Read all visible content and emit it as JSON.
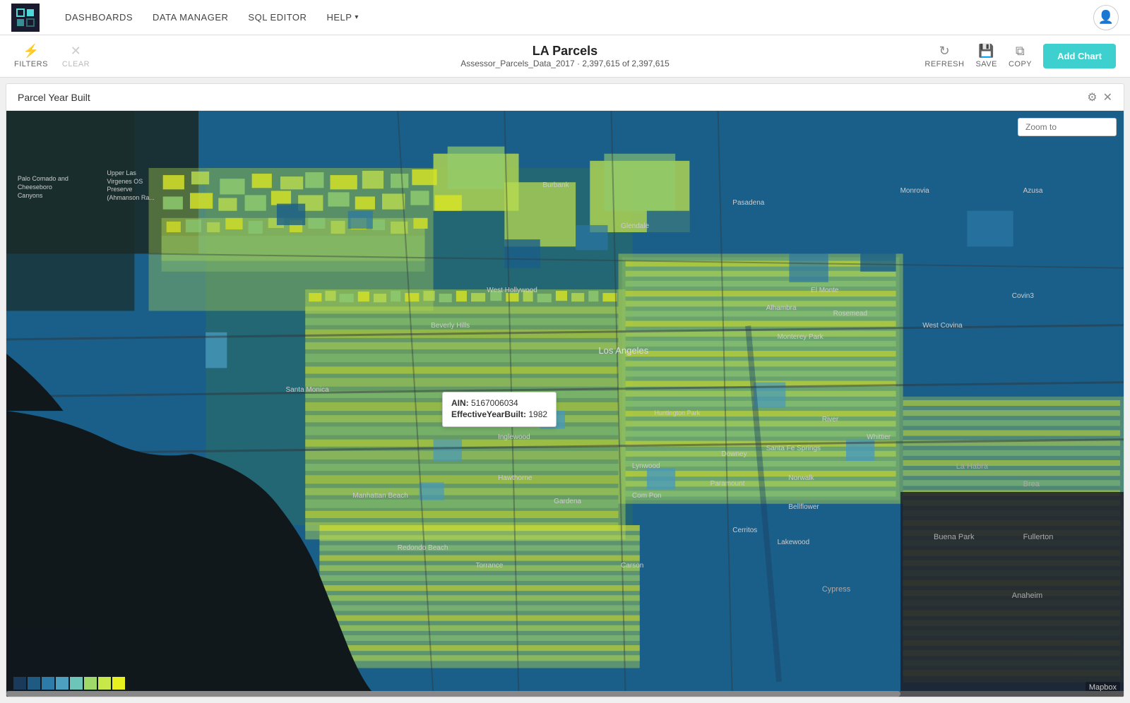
{
  "nav": {
    "logo_alt": "MAPD Logo",
    "links": [
      {
        "label": "DASHBOARDS",
        "id": "dashboards"
      },
      {
        "label": "DATA MANAGER",
        "id": "data-manager"
      },
      {
        "label": "SQL EDITOR",
        "id": "sql-editor"
      },
      {
        "label": "HELP",
        "id": "help",
        "has_arrow": true
      }
    ]
  },
  "toolbar": {
    "filters_label": "FILTERS",
    "clear_label": "CLEAR",
    "title": "LA Parcels",
    "subtitle_dataset": "Assessor_Parcels_Data_2017",
    "subtitle_count": "2,397,615 of 2,397,615",
    "refresh_label": "REFRESH",
    "save_label": "SAVE",
    "copy_label": "COPY",
    "add_chart_label": "Add Chart"
  },
  "map_panel": {
    "title": "Parcel Year Built",
    "zoom_placeholder": "Zoom to",
    "tooltip": {
      "ain_label": "AIN:",
      "ain_value": "5167006034",
      "year_label": "EffectiveYearBuilt:",
      "year_value": "1982"
    },
    "mapbox_attribution": "Mapbox"
  },
  "legend": {
    "colors": [
      "#1a3a5c",
      "#1e5a82",
      "#2d7ba8",
      "#4da0c0",
      "#6dc4b8",
      "#9fd96a",
      "#c8e84a",
      "#e8f020"
    ]
  },
  "city_labels": [
    {
      "name": "Burbank",
      "top": "12%",
      "left": "52%"
    },
    {
      "name": "Glendale",
      "top": "19%",
      "left": "58%"
    },
    {
      "name": "Pasadena",
      "top": "16%",
      "left": "68%"
    },
    {
      "name": "Monrovia",
      "top": "14%",
      "left": "82%"
    },
    {
      "name": "West Hollywood",
      "top": "30%",
      "left": "45%"
    },
    {
      "name": "Beverly Hills",
      "top": "36%",
      "left": "40%"
    },
    {
      "name": "Los Angeles",
      "top": "39%",
      "left": "57%"
    },
    {
      "name": "Alhambra",
      "top": "35%",
      "left": "69%"
    },
    {
      "name": "El Monte",
      "top": "32%",
      "left": "72%"
    },
    {
      "name": "Rosemead",
      "top": "35%",
      "left": "74%"
    },
    {
      "name": "Monterey Park",
      "top": "38%",
      "left": "69%"
    },
    {
      "name": "West Covina",
      "top": "37%",
      "left": "83%"
    },
    {
      "name": "Covin3",
      "top": "32%",
      "left": "90%"
    },
    {
      "name": "Santa Monica",
      "top": "47%",
      "left": "28%"
    },
    {
      "name": "Inglewood",
      "top": "56%",
      "left": "46%"
    },
    {
      "name": "Hawthorne",
      "top": "63%",
      "left": "46%"
    },
    {
      "name": "Manhattan Beach",
      "top": "66%",
      "left": "34%"
    },
    {
      "name": "Gardena",
      "top": "67%",
      "left": "52%"
    },
    {
      "name": "Compton",
      "top": "66%",
      "left": "58%"
    },
    {
      "name": "Paramount",
      "top": "64%",
      "left": "64%"
    },
    {
      "name": "Lynwood",
      "top": "61%",
      "left": "58%"
    },
    {
      "name": "Norwalk",
      "top": "63%",
      "left": "72%"
    },
    {
      "name": "Downey",
      "top": "60%",
      "left": "66%"
    },
    {
      "name": "Bellflower",
      "top": "68%",
      "left": "72%"
    },
    {
      "name": "Santa Fe Springs",
      "top": "59%",
      "left": "68%"
    },
    {
      "name": "Whittier",
      "top": "57%",
      "left": "78%"
    },
    {
      "name": "River",
      "top": "54%",
      "left": "75%"
    },
    {
      "name": "Redondo Beach",
      "top": "75%",
      "left": "38%"
    },
    {
      "name": "Torrance",
      "top": "78%",
      "left": "44%"
    },
    {
      "name": "Carson",
      "top": "78%",
      "left": "58%"
    },
    {
      "name": "Lakewood",
      "top": "74%",
      "left": "72%"
    },
    {
      "name": "Cerritos",
      "top": "72%",
      "left": "68%"
    },
    {
      "name": "Cypress",
      "top": "82%",
      "left": "74%"
    },
    {
      "name": "La Habra",
      "top": "60%",
      "left": "86%"
    },
    {
      "name": "Brea",
      "top": "63%",
      "left": "91%"
    },
    {
      "name": "Buena Park",
      "top": "72%",
      "left": "84%"
    },
    {
      "name": "Fullerton",
      "top": "72%",
      "left": "90%"
    },
    {
      "name": "Anaheim",
      "top": "82%",
      "left": "91%"
    },
    {
      "name": "Palo Comado and Cheeseboro Canyons",
      "top": "12%",
      "left": "1%"
    },
    {
      "name": "Upper Las Virgenes OS Preserve (Ahmanson Ra",
      "top": "11%",
      "left": "6%"
    }
  ]
}
